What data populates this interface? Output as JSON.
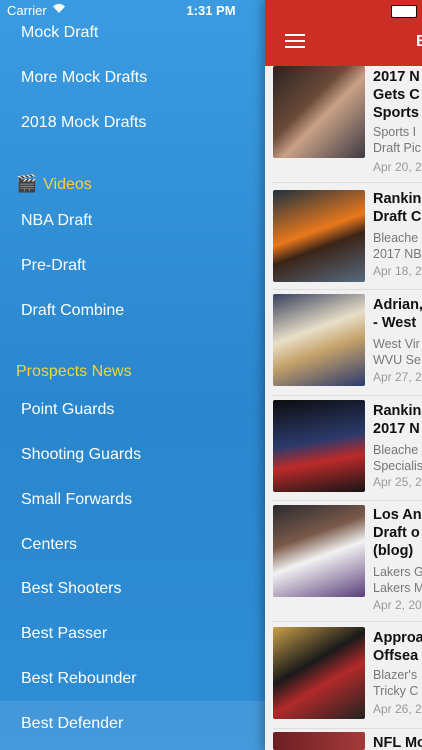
{
  "status_bar": {
    "carrier": "Carrier",
    "time": "1:31 PM"
  },
  "drawer": {
    "items": [
      {
        "label": "Mock Draft"
      },
      {
        "label": "More Mock Drafts"
      },
      {
        "label": "2018 Mock Drafts"
      }
    ],
    "videos_section": {
      "icon": "clapperboard-icon",
      "label": "Videos"
    },
    "video_items": [
      {
        "label": "NBA Draft"
      },
      {
        "label": "Pre-Draft"
      },
      {
        "label": "Draft Combine"
      }
    ],
    "prospects_section": {
      "label": "Prospects News"
    },
    "prospect_items": [
      {
        "label": "Point Guards"
      },
      {
        "label": "Shooting Guards"
      },
      {
        "label": "Small Forwards"
      },
      {
        "label": "Centers"
      },
      {
        "label": "Best Shooters"
      },
      {
        "label": "Best Passer"
      },
      {
        "label": "Best Rebounder"
      },
      {
        "label": "Best Defender"
      }
    ]
  },
  "content": {
    "title": "B",
    "articles": [
      {
        "title": "2017 N\nGets C\nSports",
        "source": "Sports I\nDraft Pic",
        "date": "Apr 20, 2"
      },
      {
        "title": "Rankin\nDraft C",
        "source": "Bleache\n2017 NB",
        "date": "Apr 18, 2"
      },
      {
        "title": "Adrian,\n- West",
        "source": "West Vir\nWVU Se",
        "date": "Apr 27, 2"
      },
      {
        "title": "Rankin\n2017 N",
        "source": "Bleache\nSpecialis",
        "date": "Apr 25, 2"
      },
      {
        "title": "Los An\nDraft o\n(blog)",
        "source": "Lakers G\nLakers M",
        "date": "Apr 2, 20"
      },
      {
        "title": "Approa\nOffsea",
        "source": "Blazer's\nTricky C",
        "date": "Apr 26, 2"
      },
      {
        "title": "NFL Mo",
        "source": "",
        "date": ""
      }
    ]
  }
}
